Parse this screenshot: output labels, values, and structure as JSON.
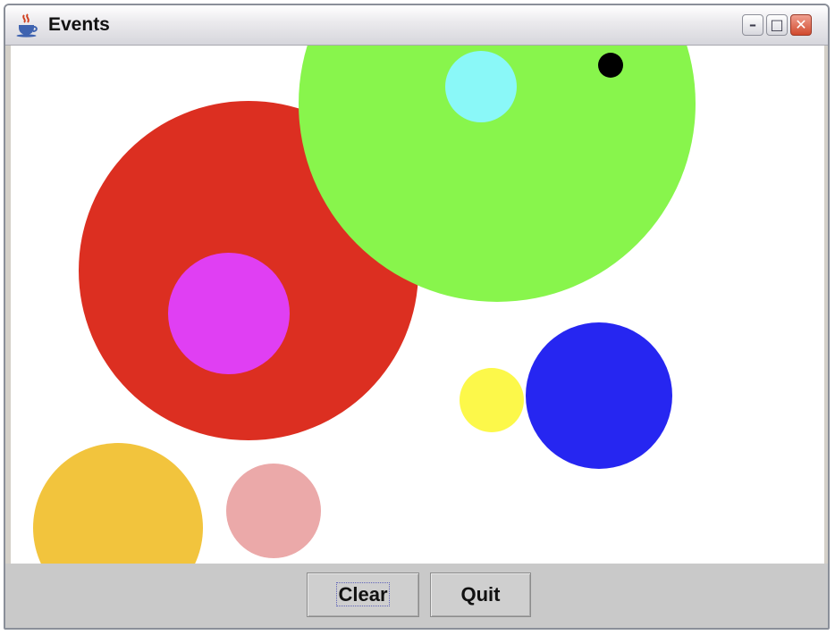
{
  "window": {
    "title": "Events",
    "controls": {
      "minimize": "–",
      "maximize": "□",
      "close": "✕"
    }
  },
  "canvas": {
    "circles": [
      {
        "name": "red",
        "color": "#dc2f21"
      },
      {
        "name": "magenta",
        "color": "#e03ff3"
      },
      {
        "name": "green",
        "color": "#88f54c"
      },
      {
        "name": "cyan",
        "color": "#8af8f8"
      },
      {
        "name": "black",
        "color": "#000000"
      },
      {
        "name": "yellow",
        "color": "#fcf84a"
      },
      {
        "name": "blue",
        "color": "#2626f1"
      },
      {
        "name": "orange",
        "color": "#f2c43d"
      },
      {
        "name": "pink",
        "color": "#eba9a9"
      }
    ]
  },
  "buttons": {
    "clear_label": "Clear",
    "quit_label": "Quit"
  }
}
